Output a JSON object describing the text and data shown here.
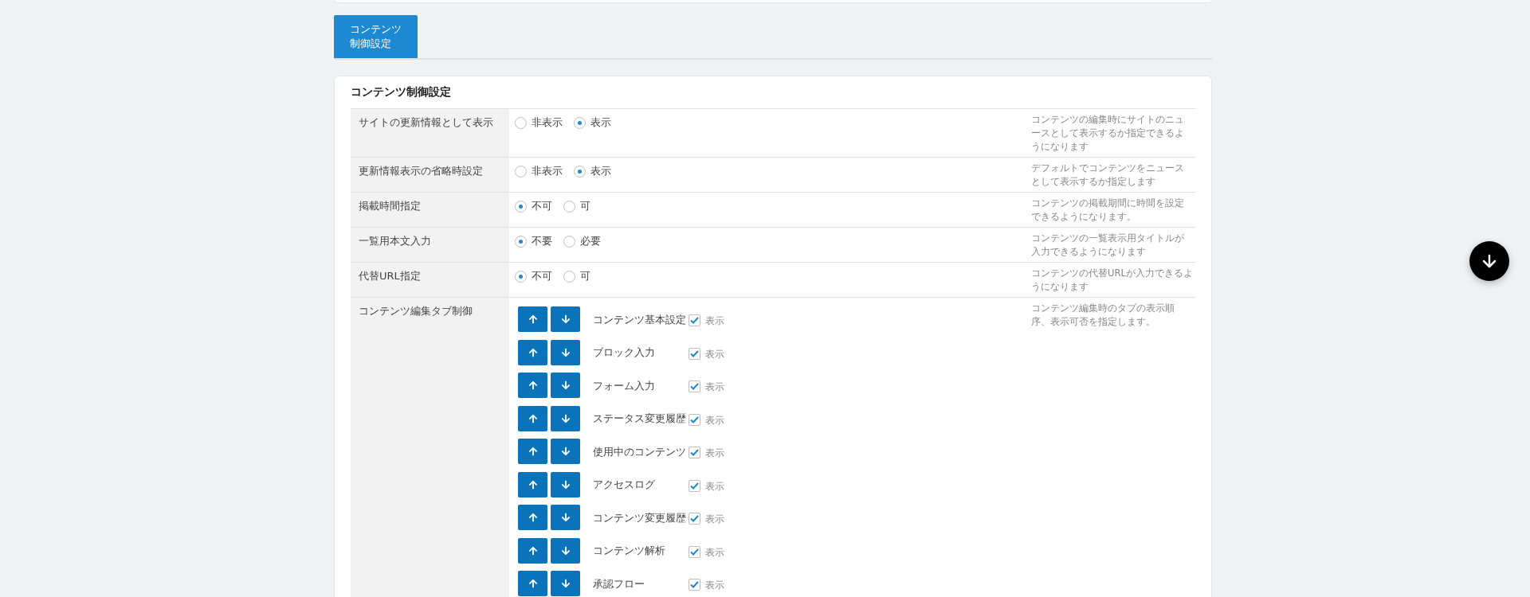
{
  "tabs": [
    {
      "label": "コンテンツ制御設定",
      "selected": true
    }
  ],
  "section": {
    "title": "コンテンツ制御設定",
    "settings": [
      {
        "kind": "radio",
        "label": "サイトの更新情報として表示",
        "options": [
          {
            "label": "非表示",
            "selected": false
          },
          {
            "label": "表示",
            "selected": true
          }
        ],
        "description": "コンテンツの編集時にサイトのニュースとして表示するか指定できるようになります"
      },
      {
        "kind": "radio",
        "label": "更新情報表示の省略時設定",
        "options": [
          {
            "label": "非表示",
            "selected": false
          },
          {
            "label": "表示",
            "selected": true
          }
        ],
        "description": "デフォルトでコンテンツをニュースとして表示するか指定します"
      },
      {
        "kind": "radio",
        "label": "掲載時間指定",
        "options": [
          {
            "label": "不可",
            "selected": true
          },
          {
            "label": "可",
            "selected": false
          }
        ],
        "description": "コンテンツの掲載期間に時間を設定できるようになります。"
      },
      {
        "kind": "radio",
        "label": "一覧用本文入力",
        "options": [
          {
            "label": "不要",
            "selected": true
          },
          {
            "label": "必要",
            "selected": false
          }
        ],
        "description": "コンテンツの一覧表示用タイトルが入力できるようになります"
      },
      {
        "kind": "radio",
        "label": "代替URL指定",
        "options": [
          {
            "label": "不可",
            "selected": true
          },
          {
            "label": "可",
            "selected": false
          }
        ],
        "description": "コンテンツの代替URLが入力できるようになります"
      },
      {
        "kind": "tab_order",
        "label": "コンテンツ編集タブ制御",
        "tabs": [
          {
            "name": "コンテンツ基本設定",
            "checked": true,
            "checkbox_label": "表示"
          },
          {
            "name": "ブロック入力",
            "checked": true,
            "checkbox_label": "表示"
          },
          {
            "name": "フォーム入力",
            "checked": true,
            "checkbox_label": "表示"
          },
          {
            "name": "ステータス変更履歴",
            "checked": true,
            "checkbox_label": "表示"
          },
          {
            "name": "使用中のコンテンツ",
            "checked": true,
            "checkbox_label": "表示"
          },
          {
            "name": "アクセスログ",
            "checked": true,
            "checkbox_label": "表示"
          },
          {
            "name": "コンテンツ変更履歴",
            "checked": true,
            "checkbox_label": "表示"
          },
          {
            "name": "コンテンツ解析",
            "checked": true,
            "checkbox_label": "表示"
          },
          {
            "name": "承認フロー",
            "checked": true,
            "checkbox_label": "表示"
          }
        ],
        "description": "コンテンツ編集時のタブの表示順序、表示可否を指定します。"
      }
    ]
  }
}
